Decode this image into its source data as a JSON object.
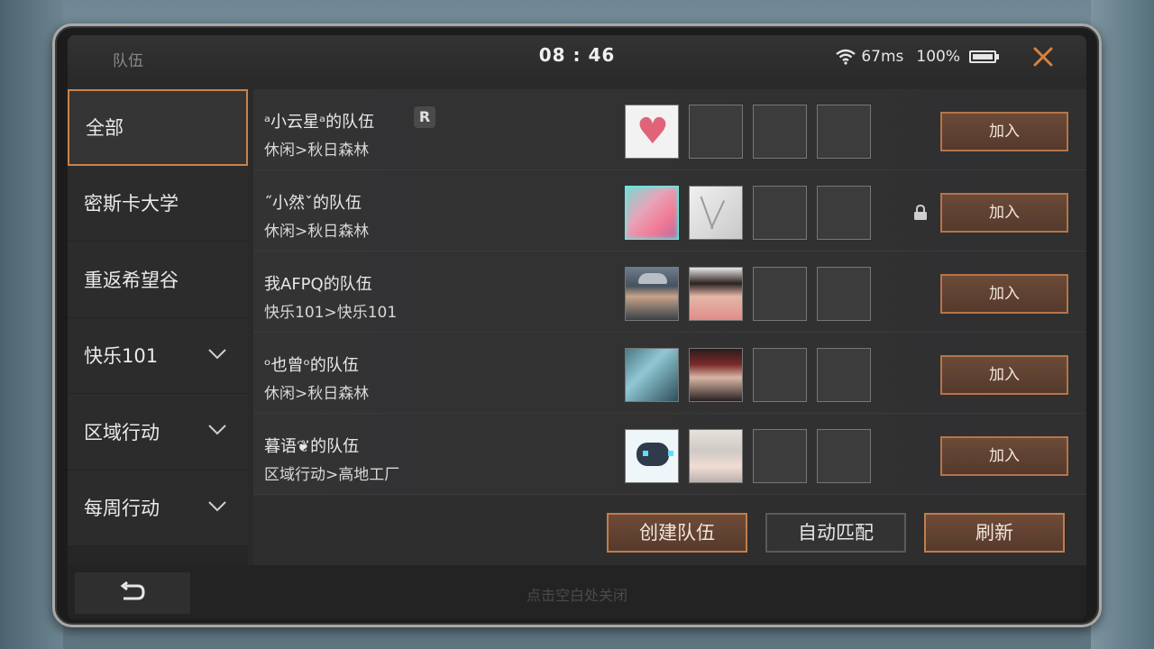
{
  "statusbar": {
    "title": "队伍",
    "time": "08 : 46",
    "ping": "67ms",
    "battery": "100%",
    "battery_level": 1.0
  },
  "sidebar": {
    "items": [
      {
        "label": "全部",
        "active": true,
        "expandable": false
      },
      {
        "label": "密斯卡大学",
        "active": false,
        "expandable": false
      },
      {
        "label": "重返希望谷",
        "active": false,
        "expandable": false
      },
      {
        "label": "快乐101",
        "active": false,
        "expandable": true
      },
      {
        "label": "区域行动",
        "active": false,
        "expandable": true
      },
      {
        "label": "每周行动",
        "active": false,
        "expandable": true
      }
    ]
  },
  "teams": [
    {
      "name": "ᵃ小云星ᵃ的队伍",
      "mode": "休闲>秋日森林",
      "badge": "R",
      "locked": false,
      "join_label": "加入",
      "members": [
        "heart-avatar",
        null,
        null,
        null
      ]
    },
    {
      "name": "˝小然ˇ的队伍",
      "mode": "休闲>秋日森林",
      "badge": null,
      "locked": true,
      "join_label": "加入",
      "members": [
        "pink-avatar",
        "sketch-avatar",
        null,
        null
      ]
    },
    {
      "name": "我AFPQ的队伍",
      "mode": "快乐101>快乐101",
      "badge": null,
      "locked": false,
      "join_label": "加入",
      "members": [
        "cap-avatar",
        "girl-avatar",
        null,
        null
      ]
    },
    {
      "name": "ᵒ也曾ᵒ的队伍",
      "mode": "休闲>秋日森林",
      "badge": null,
      "locked": false,
      "join_label": "加入",
      "members": [
        "scene-avatar",
        "red-avatar",
        null,
        null
      ]
    },
    {
      "name": "暮语❦的队伍",
      "mode": "区域行动>高地工厂",
      "badge": null,
      "locked": false,
      "join_label": "加入",
      "members": [
        "robot-avatar",
        "white-avatar",
        null,
        null
      ]
    }
  ],
  "actions": {
    "create": "创建队伍",
    "auto_match": "自动匹配",
    "refresh": "刷新"
  },
  "footer": {
    "hint": "点击空白处关闭"
  },
  "colors": {
    "accent": "#c07e4c",
    "close": "#d7823e"
  }
}
